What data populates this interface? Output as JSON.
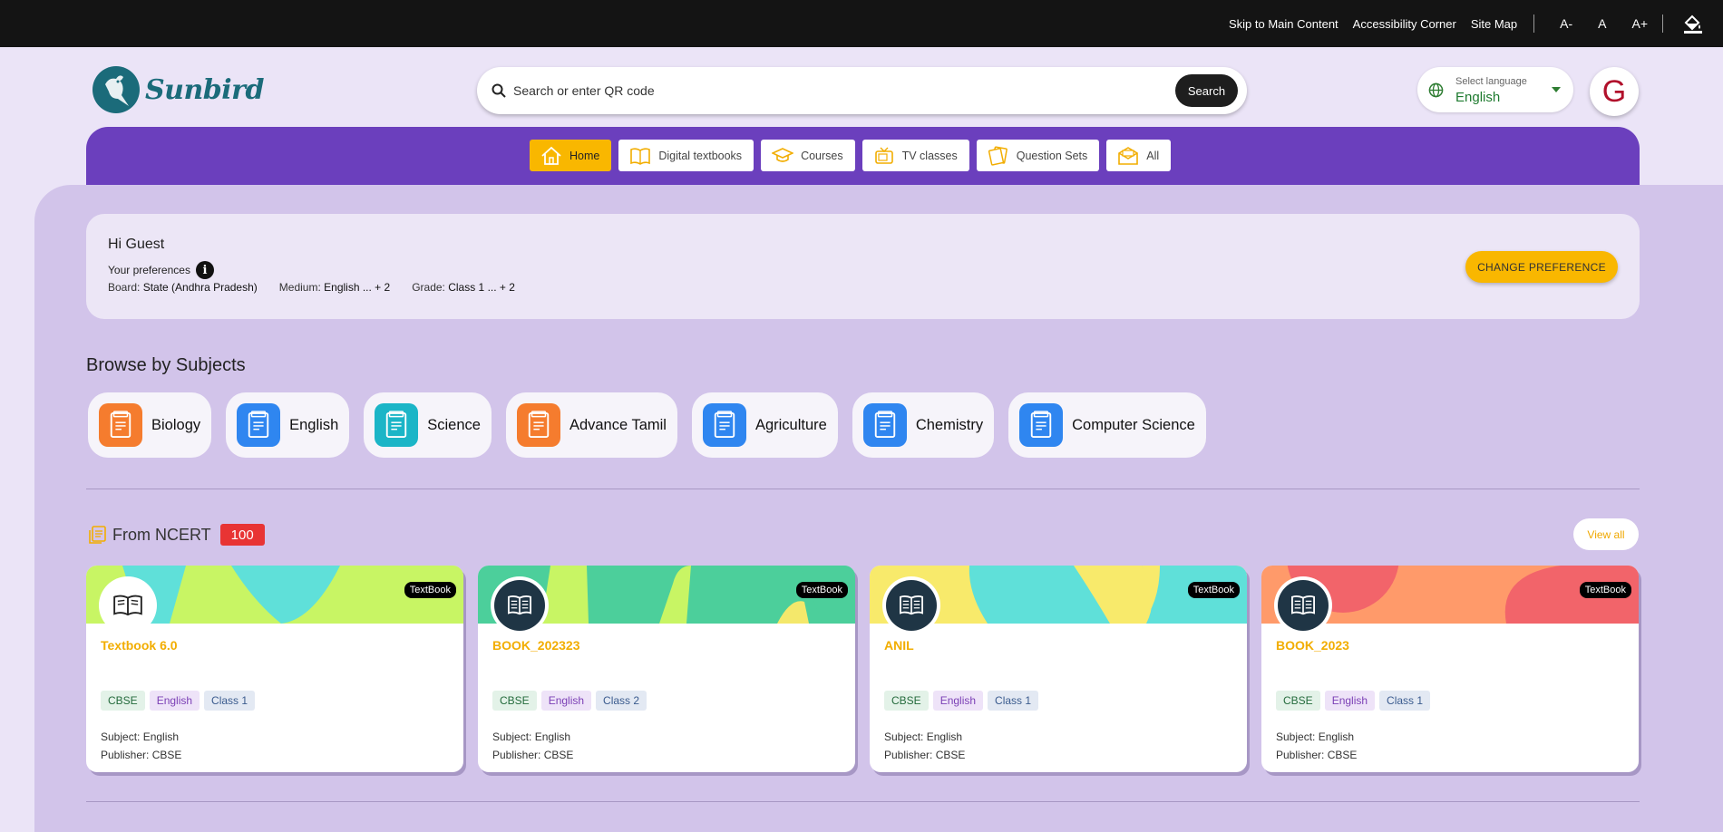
{
  "topbar": {
    "skip": "Skip to Main Content",
    "accessibility": "Accessibility Corner",
    "sitemap": "Site Map",
    "font_decrease": "A-",
    "font_reset": "A",
    "font_increase": "A+"
  },
  "header": {
    "logo_text": "Sunbird",
    "search_placeholder": "Search or enter QR code",
    "search_button": "Search",
    "language_caption": "Select language",
    "language_value": "English",
    "avatar_initial": "G"
  },
  "nav": {
    "tabs": [
      {
        "label": "Home",
        "icon": "home-icon"
      },
      {
        "label": "Digital textbooks",
        "icon": "book-icon"
      },
      {
        "label": "Courses",
        "icon": "graduation-cap-icon"
      },
      {
        "label": "TV classes",
        "icon": "tv-icon"
      },
      {
        "label": "Question Sets",
        "icon": "question-sets-icon"
      },
      {
        "label": "All",
        "icon": "all-icon"
      }
    ],
    "active": "Home"
  },
  "greeting": {
    "hi": "Hi Guest",
    "preferences_label": "Your preferences",
    "info_glyph": "i",
    "board_label": "Board:",
    "board_value": "State (Andhra Pradesh)",
    "medium_label": "Medium:",
    "medium_value": "English ... + 2",
    "grade_label": "Grade:",
    "grade_value": "Class 1 ... + 2",
    "change_button": "CHANGE PREFERENCE"
  },
  "browse": {
    "heading": "Browse by Subjects",
    "subjects": [
      {
        "label": "Biology",
        "color": "#f57c2e"
      },
      {
        "label": "English",
        "color": "#2f86f0"
      },
      {
        "label": "Science",
        "color": "#1bb5c7"
      },
      {
        "label": "Advance Tamil",
        "color": "#f57c2e"
      },
      {
        "label": "Agriculture",
        "color": "#2f86f0"
      },
      {
        "label": "Chemistry",
        "color": "#2f86f0"
      },
      {
        "label": "Computer Science",
        "color": "#2f86f0"
      }
    ]
  },
  "ncert": {
    "heading": "From NCERT",
    "count": "100",
    "view_all": "View all",
    "cards": [
      {
        "type": "TextBook",
        "title": "Textbook 6.0",
        "board": "CBSE",
        "medium": "English",
        "grade": "Class 1",
        "subject": "Subject: English",
        "publisher": "Publisher: CBSE",
        "thumb": "open-book-icon"
      },
      {
        "type": "TextBook",
        "title": "BOOK_202323",
        "board": "CBSE",
        "medium": "English",
        "grade": "Class 2",
        "subject": "Subject: English",
        "publisher": "Publisher: CBSE",
        "thumb": "book-icon"
      },
      {
        "type": "TextBook",
        "title": "ANIL",
        "board": "CBSE",
        "medium": "English",
        "grade": "Class 1",
        "subject": "Subject: English",
        "publisher": "Publisher: CBSE",
        "thumb": "book-icon"
      },
      {
        "type": "TextBook",
        "title": "BOOK_2023",
        "board": "CBSE",
        "medium": "English",
        "grade": "Class 1",
        "subject": "Subject: English",
        "publisher": "Publisher: CBSE",
        "thumb": "book-icon"
      }
    ]
  },
  "colors": {
    "accent": "#f9b700",
    "nav_purple": "#6b3fbd",
    "panel": "#d2c4ea",
    "badge_red": "#e83434"
  }
}
